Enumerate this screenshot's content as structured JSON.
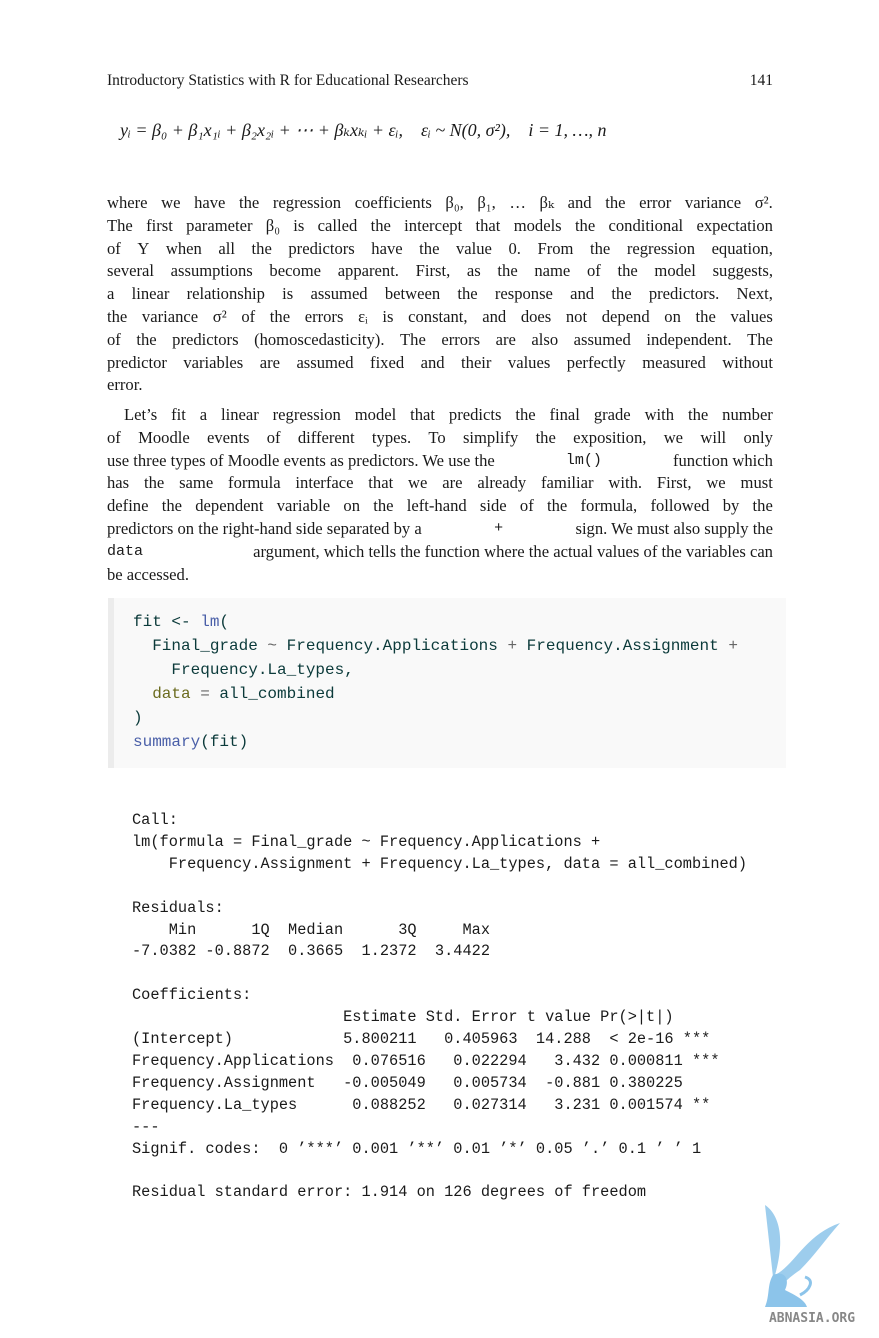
{
  "header": {
    "title": "Introductory Statistics with R for Educational Researchers",
    "page_number": "141"
  },
  "equation": "yᵢ = β₀ + β₁x₁ᵢ + β₂x₂ᵢ + ⋯ + βₖxₖᵢ + εᵢ,    εᵢ ~ N(0, σ²),    i = 1, …, n",
  "paragraph1": [
    "where we have the regression coefficients β₀, β₁, … βₖ and the error variance σ².",
    "The first parameter β₀ is called the intercept that models the conditional expectation",
    "of Y when all the predictors have the value 0. From the regression equation,",
    "several assumptions become apparent. First, as the name of the model suggests,",
    "a linear relationship is assumed between the response and the predictors. Next,",
    "the variance σ² of the errors εᵢ is constant, and does not depend on the values",
    "of the predictors (homoscedasticity). The errors are also assumed independent. The",
    "predictor variables are assumed fixed and their values perfectly measured without",
    "error."
  ],
  "paragraph2": {
    "l1": "Let’s fit a linear regression model that predicts the final grade with the number",
    "l2": "of Moodle events of different types. To simplify the exposition, we will only",
    "l3a": "use three types of Moodle events as predictors. We use the",
    "l3code": "lm()",
    "l3b": "function which",
    "l4": "has the same formula interface that we are already familiar with. First, we must",
    "l5": "define the dependent variable on the left-hand side of the formula, followed by the",
    "l6a": "predictors on the right-hand side separated by a",
    "l6code": "+",
    "l6b": "sign. We must also supply the",
    "l7code": "data",
    "l7b": "argument, which tells the function where the actual values of the variables can",
    "l8": "be accessed."
  },
  "code": {
    "l1a": "fit <- ",
    "l1fn": "lm",
    "l1b": "(",
    "l2a": "  Final_grade ",
    "l2op": "~",
    "l2b": " Frequency.Applications ",
    "l2op2": "+",
    "l2c": " Frequency.Assignment ",
    "l2op3": "+",
    "l3": "    Frequency.La_types,",
    "l4kw": "  data",
    "l4op": " = ",
    "l4b": "all_combined",
    "l5": ")",
    "l6fn": "summary",
    "l6b": "(fit)"
  },
  "output": "Call:\nlm(formula = Final_grade ~ Frequency.Applications + \n    Frequency.Assignment + Frequency.La_types, data = all_combined)\n\nResiduals:\n    Min      1Q  Median      3Q     Max \n-7.0382 -0.8872  0.3665  1.2372  3.4422 \n\nCoefficients:\n                       Estimate Std. Error t value Pr(>|t|)    \n(Intercept)            5.800211   0.405963  14.288  < 2e-16 ***\nFrequency.Applications  0.076516   0.022294   3.432 0.000811 ***\nFrequency.Assignment   -0.005049   0.005734  -0.881 0.380225    \nFrequency.La_types      0.088252   0.027314   3.231 0.001574 ** \n---\nSignif. codes:  0 ’***’ 0.001 ’**’ 0.01 ’*’ 0.05 ’.’ 0.1 ’ ’ 1\n\nResidual standard error: 1.914 on 126 degrees of freedom",
  "watermark": "ABNASIA.ORG"
}
